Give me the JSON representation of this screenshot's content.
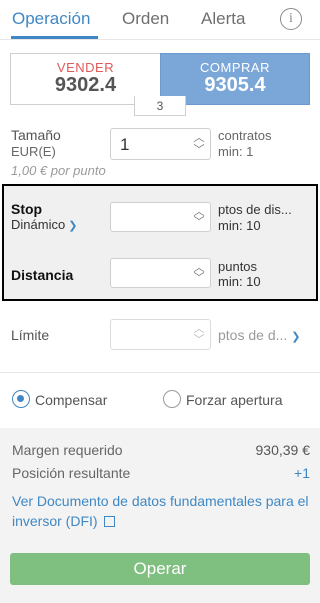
{
  "tabs": [
    {
      "label": "Operación",
      "active": true
    },
    {
      "label": "Orden",
      "active": false
    },
    {
      "label": "Alerta",
      "active": false
    }
  ],
  "info_icon": "i",
  "prices": {
    "sell_label": "VENDER",
    "sell_value": "9302.4",
    "buy_label": "COMPRAR",
    "buy_value": "9305.4",
    "spread": "3"
  },
  "size": {
    "label": "Tamaño",
    "currency": "EUR(E)",
    "hint": "1,00 € por punto",
    "value": "1",
    "unit": "contratos",
    "min": "min: 1"
  },
  "stop": {
    "label": "Stop",
    "type": "Dinámico",
    "value": "",
    "unit": "ptos de dis...",
    "min": "min: 10"
  },
  "distance": {
    "label": "Distancia",
    "value": "",
    "unit": "puntos",
    "min": "min: 10"
  },
  "limit": {
    "label": "Límite",
    "value": "",
    "unit": "ptos de d..."
  },
  "radios": {
    "compensate": "Compensar",
    "force_open": "Forzar apertura",
    "selected": "compensate"
  },
  "summary": {
    "margin_label": "Margen requerido",
    "margin_value": "930,39 €",
    "position_label": "Posición resultante",
    "position_value": "+1",
    "link_text": "Ver Documento de datos fundamentales para el inversor (DFI)"
  },
  "operate_label": "Operar",
  "colors": {
    "accent": "#3f88c5",
    "sell": "#e05a5a",
    "buy_bg": "#7aa7d8",
    "operate_bg": "#7fbf7f"
  }
}
